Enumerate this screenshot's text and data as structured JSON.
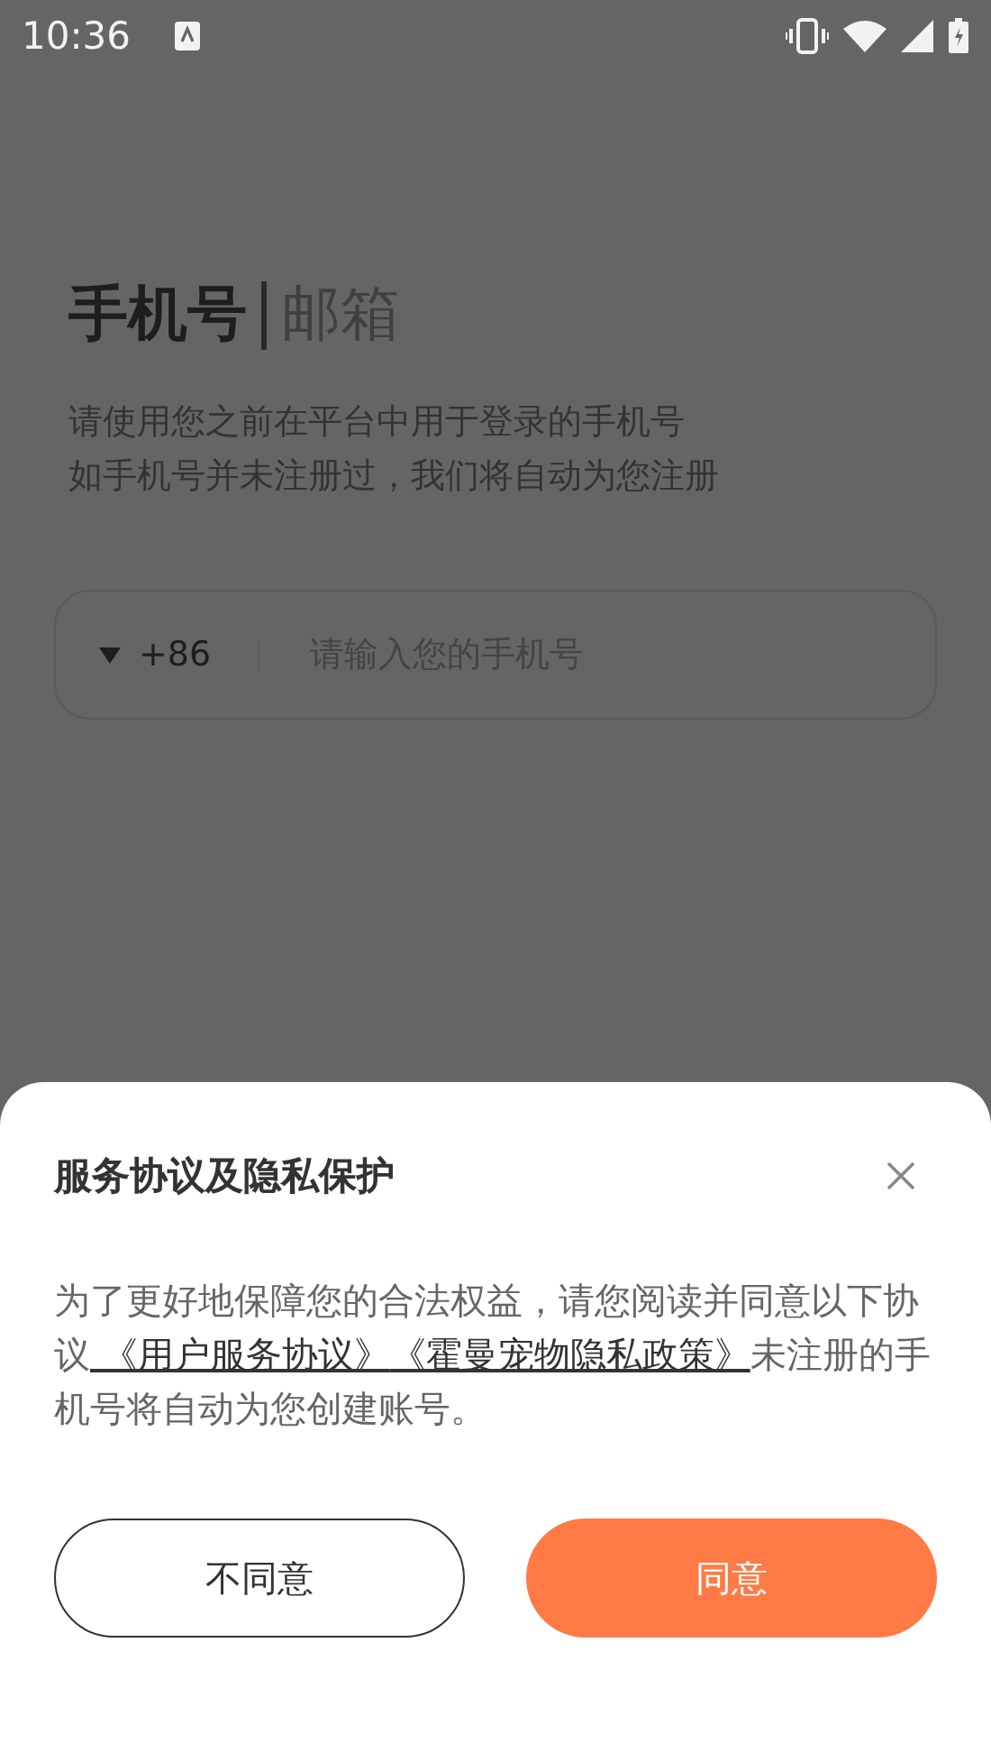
{
  "status_bar": {
    "time": "10:36"
  },
  "login": {
    "tabs": [
      {
        "label": "手机号",
        "selected": true
      },
      {
        "label": "邮箱",
        "selected": false
      }
    ],
    "hint_lines": [
      "请使用您之前在平台中用于登录的手机号",
      "如手机号并未注册过，我们将自动为您注册"
    ],
    "phone_field": {
      "country_code": "+86",
      "placeholder": "请输入您的手机号"
    }
  },
  "dialog": {
    "title": "服务协议及隐私保护",
    "body_before": "为了更好地保障您的合法权益，请您阅读并同意以下协议",
    "links": [
      " 《用户服务协议》",
      "《霍曼宠物隐私政策》"
    ],
    "body_after": "未注册的手机号将自动为您创建账号。",
    "buttons": [
      {
        "label": "不同意",
        "kind": "secondary"
      },
      {
        "label": "同意",
        "kind": "primary"
      }
    ]
  }
}
